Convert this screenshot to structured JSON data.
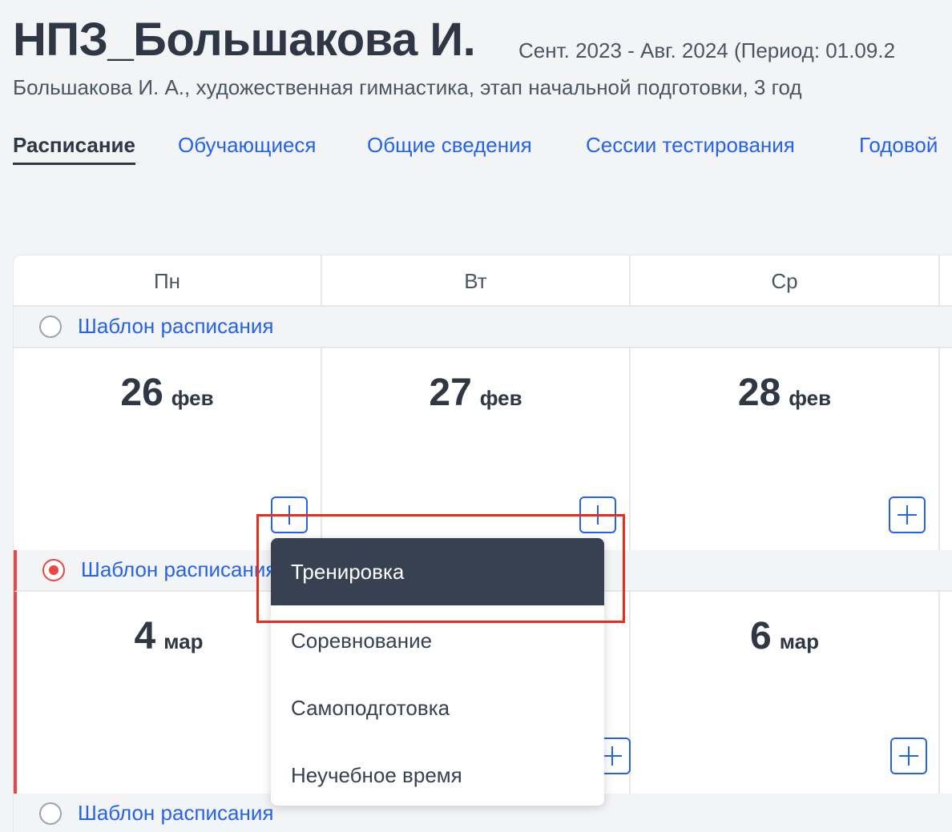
{
  "header": {
    "title": "НПЗ_Большакова И.",
    "period": "Сент. 2023 - Авг. 2024 (Период: 01.09.2",
    "subtitle": "Большакова И. А., художественная гимнастика, этап начальной подготовки, 3 год"
  },
  "tabs": [
    {
      "label": "Расписание",
      "active": true
    },
    {
      "label": "Обучающиеся",
      "active": false
    },
    {
      "label": "Общие сведения",
      "active": false
    },
    {
      "label": "Сессии тестирования",
      "active": false
    },
    {
      "label": "Годовой",
      "active": false
    }
  ],
  "calendar": {
    "days": [
      "Пн",
      "Вт",
      "Ср"
    ],
    "weeks": [
      {
        "template_label": "Шаблон расписания",
        "selected": false,
        "dates": [
          {
            "num": "26",
            "month": "фев"
          },
          {
            "num": "27",
            "month": "фев"
          },
          {
            "num": "28",
            "month": "фев"
          }
        ]
      },
      {
        "template_label": "Шаблон расписания",
        "selected": true,
        "dates": [
          {
            "num": "4",
            "month": "мар"
          },
          {
            "num": "",
            "month": ""
          },
          {
            "num": "6",
            "month": "мар"
          }
        ]
      },
      {
        "template_label": "Шаблон расписания",
        "selected": false
      }
    ]
  },
  "menu": {
    "items": [
      "Тренировка",
      "Соревнование",
      "Самоподготовка",
      "Неучебное время"
    ],
    "active_index": 0
  },
  "colors": {
    "accent": "#2563eb",
    "selected_week": "#ef4444",
    "menu_active_bg": "#374151",
    "highlight": "#ee2a1b"
  },
  "icons": {
    "add": "plus-icon",
    "radio": "radio-icon"
  }
}
